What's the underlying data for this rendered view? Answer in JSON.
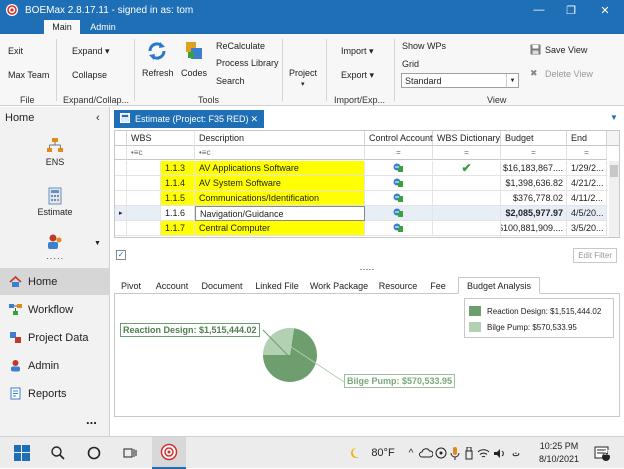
{
  "window": {
    "title": "BOEMax 2.8.17.11 - signed in as: tom",
    "accent": "#1e6fb5"
  },
  "ribbon_tabs": [
    "Main",
    "Admin"
  ],
  "ribbon": {
    "file_group": {
      "exit": "Exit",
      "max_team": "Max Team",
      "label": "File"
    },
    "expand_group": {
      "expand": "Expand",
      "collapse": "Collapse",
      "label": "Expand/Collap..."
    },
    "tools_group": {
      "refresh": "Refresh",
      "codes": "Codes",
      "recalculate": "ReCalculate",
      "process_library": "Process Library",
      "search": "Search",
      "label": "Tools"
    },
    "project_group": {
      "project": "Project"
    },
    "import_export_group": {
      "import": "Import",
      "export": "Export",
      "label": "Import/Exp..."
    },
    "view_group": {
      "show_wps": "Show WPs",
      "grid": "Grid",
      "grid_value": "Standard",
      "save_view": "Save View",
      "delete_view": "Delete View",
      "label": "View"
    }
  },
  "nav": {
    "header": "Home",
    "tiles": [
      {
        "label": "ENS",
        "icon": "ens-icon"
      },
      {
        "label": "Estimate",
        "icon": "estimate-icon"
      }
    ],
    "items": [
      {
        "label": "Home",
        "icon": "home-icon",
        "selected": true
      },
      {
        "label": "Workflow",
        "icon": "workflow-icon"
      },
      {
        "label": "Project Data",
        "icon": "project-data-icon"
      },
      {
        "label": "Admin",
        "icon": "admin-icon"
      },
      {
        "label": "Reports",
        "icon": "reports-icon"
      }
    ],
    "more": "..."
  },
  "doc_tab": {
    "label": "Estimate (Project: F35 RED)"
  },
  "grid": {
    "columns": [
      "WBS",
      "Description",
      "Control Account",
      "WBS Dictionary",
      "Budget",
      "End"
    ],
    "rows": [
      {
        "wbs": "1.1.3",
        "description": "AV Applications Software",
        "has_control_account": true,
        "dictionary": true,
        "budget": "$16,183,867....",
        "end": "1/29/2...",
        "highlight": true
      },
      {
        "wbs": "1.1.4",
        "description": "AV System Software",
        "has_control_account": true,
        "dictionary": false,
        "budget": "$1,398,636.82",
        "end": "4/21/2...",
        "highlight": true
      },
      {
        "wbs": "1.1.5",
        "description": "Communications/Identification",
        "has_control_account": true,
        "dictionary": false,
        "budget": "$376,778.02",
        "end": "4/11/2...",
        "highlight": true
      },
      {
        "wbs": "1.1.6",
        "description": "Navigation/Guidance",
        "has_control_account": true,
        "dictionary": false,
        "budget": "$2,085,977.97",
        "end": "4/5/20...",
        "highlight": false,
        "current": true
      },
      {
        "wbs": "1.1.7",
        "description": "Central Computer",
        "has_control_account": true,
        "dictionary": false,
        "budget": "$100,881,909....",
        "end": "3/5/20...",
        "highlight": true
      }
    ],
    "edit_filter": "Edit Filter"
  },
  "detail_tabs": [
    "Pivot",
    "Account",
    "Document",
    "Linked File",
    "Work Package",
    "Resource",
    "Fee",
    "Budget Analysis"
  ],
  "detail_selected": "Budget Analysis",
  "chart_data": {
    "type": "pie",
    "slices": [
      {
        "name": "Reaction Design",
        "value": 1515444.02,
        "label": "Reaction Design: $1,515,444.02",
        "color": "#6e9e6e"
      },
      {
        "name": "Bilge Pump",
        "value": 570533.95,
        "label": "Bilge Pump: $570,533.95",
        "color": "#b2d0b2"
      }
    ],
    "legend": [
      "Reaction Design: $1,515,444.02",
      "Bilge Pump: $570,533.95"
    ],
    "legend_position": "top-right"
  },
  "taskbar": {
    "temperature": "80°F",
    "time": "10:25 PM",
    "date": "8/10/2021",
    "notifications": "11"
  }
}
